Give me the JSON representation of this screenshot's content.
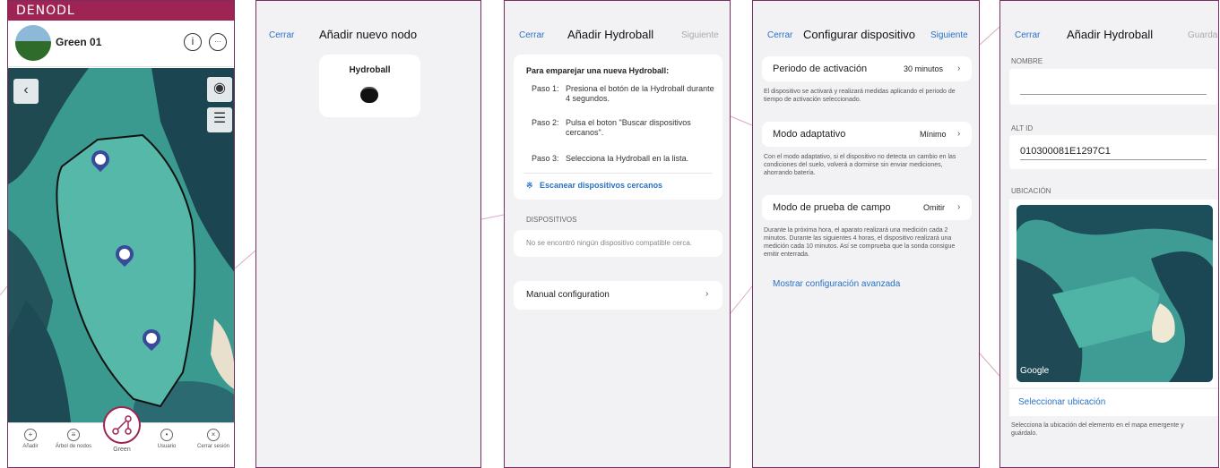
{
  "screen1": {
    "logo": "DENODL",
    "title": "Green 01",
    "info_icon": "i",
    "more_icon": "···",
    "tabs": [
      {
        "label": "Añadir",
        "icon": "+"
      },
      {
        "label": "Árbol de nodos",
        "icon": "≡"
      },
      {
        "label": "Green",
        "icon": ""
      },
      {
        "label": "Usuario",
        "icon": "•"
      },
      {
        "label": "Cerrar sesión",
        "icon": "×"
      }
    ]
  },
  "screen2": {
    "cancel": "Cerrar",
    "title": "Añadir nuevo nodo",
    "option_label": "Hydroball"
  },
  "screen3": {
    "cancel": "Cerrar",
    "title": "Añadir Hydroball",
    "next": "Siguiente",
    "instructions_title": "Para emparejar una nueva Hydroball:",
    "steps": [
      {
        "label": "Paso 1:",
        "text": "Presiona el botón de la Hydroball durante 4 segundos."
      },
      {
        "label": "Paso 2:",
        "text": "Pulsa el boton \"Buscar dispositivos cercanos\"."
      },
      {
        "label": "Paso 3:",
        "text": "Selecciona la Hydroball en la lista."
      }
    ],
    "scan_link": "Escanear dispositivos cercanos",
    "devices_header": "DISPOSITIVOS",
    "no_devices": "No se encontró ningún dispositivo compatible cerca.",
    "manual": "Manual configuration"
  },
  "screen4": {
    "cancel": "Cerrar",
    "title": "Configurar dispositivo",
    "next": "Siguiente",
    "rows": [
      {
        "label": "Periodo de activación",
        "value": "30 minutos",
        "desc": "El dispositivo se activará y realizará medidas aplicando el periodo de tiempo de activación seleccionado."
      },
      {
        "label": "Modo adaptativo",
        "value": "Mínimo",
        "desc": "Con el modo adaptativo, si el dispositivo no detecta un cambio en las condiciones del suelo, volverá a dormirse sin enviar mediciones, ahorrando batería."
      },
      {
        "label": "Modo de prueba de campo",
        "value": "Omitir",
        "desc": "Durante la próxima hora, el aparato realizará una medición cada 2 minutos. Durante las siguientes 4 horas, el dispositivo realizará una medición cada 10 minutos. Así se comprueba que la sonda consigue emitir enterrada."
      }
    ],
    "advanced": "Mostrar configuración avanzada"
  },
  "screen5": {
    "cancel": "Cerrar",
    "title": "Añadir Hydroball",
    "save": "Guardar",
    "name_label": "NOMBRE",
    "name_value": "",
    "altid_label": "ALT ID",
    "altid_value": "010300081E1297C1",
    "location_label": "UBICACIÓN",
    "map_brand": "Google",
    "select_location": "Seleccionar ubicación",
    "select_help": "Selecciona la ubicación del elemento en el mapa emergente y guárdalo."
  },
  "colors": {
    "brand": "#9e2553",
    "link": "#2a72c4",
    "frame": "#7a2e60"
  }
}
